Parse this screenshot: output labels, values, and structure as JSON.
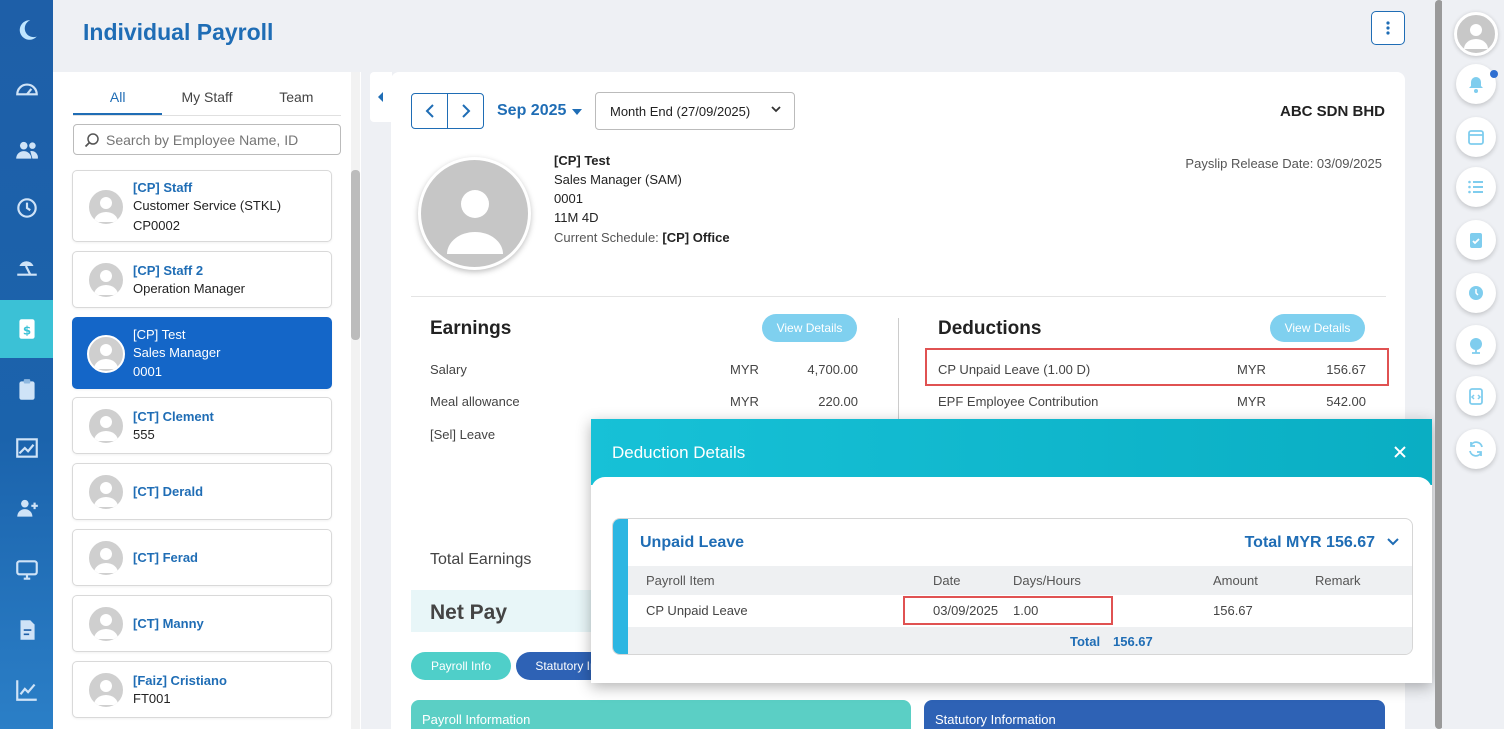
{
  "header": {
    "title": "Individual Payroll"
  },
  "left_nav": [
    "logo-icon",
    "dashboard-icon",
    "people-icon",
    "history-icon",
    "leave-icon",
    "payroll-icon",
    "clipboard-icon",
    "chart-icon",
    "add-user-icon",
    "monitor-icon",
    "document-icon",
    "report-icon"
  ],
  "employees_panel": {
    "tabs": [
      "All",
      "My Staff",
      "Team"
    ],
    "active_tab": "All",
    "search_placeholder": "Search by Employee Name, ID",
    "list": [
      {
        "name": "[CP] Staff",
        "line2": "Customer Service (STKL)",
        "line3": "CP0002"
      },
      {
        "name": "[CP] Staff 2",
        "line2": "Operation Manager",
        "line3": ""
      },
      {
        "name": "[CP] Test",
        "line2": "Sales Manager",
        "line3": "0001",
        "selected": true
      },
      {
        "name": "[CT] Clement",
        "line2": "555",
        "line3": ""
      },
      {
        "name": "[CT] Derald",
        "line2": "",
        "line3": ""
      },
      {
        "name": "[CT] Ferad",
        "line2": "",
        "line3": ""
      },
      {
        "name": "[CT] Manny",
        "line2": "",
        "line3": ""
      },
      {
        "name": "[Faiz] Cristiano",
        "line2": "FT001",
        "line3": ""
      }
    ]
  },
  "payslip": {
    "period": "Sep 2025",
    "run": "Month End (27/09/2025)",
    "company": "ABC SDN BHD",
    "employee": {
      "name": "[CP] Test",
      "position": "Sales Manager (SAM)",
      "id": "0001",
      "tenure": "11M 4D",
      "schedule_label": "Current Schedule:",
      "schedule_value": "[CP] Office"
    },
    "release_date": "Payslip Release Date: 03/09/2025",
    "earnings": {
      "title": "Earnings",
      "view_label": "View Details",
      "rows": [
        {
          "label": "Salary",
          "currency": "MYR",
          "amount": "4,700.00"
        },
        {
          "label": "Meal allowance",
          "currency": "MYR",
          "amount": "220.00"
        },
        {
          "label": "[Sel] Leave",
          "currency": "",
          "amount": ""
        }
      ],
      "total_label": "Total Earnings"
    },
    "deductions": {
      "title": "Deductions",
      "view_label": "View Details",
      "rows": [
        {
          "label": "CP Unpaid Leave (1.00 D)",
          "currency": "MYR",
          "amount": "156.67"
        },
        {
          "label": "EPF Employee Contribution",
          "currency": "MYR",
          "amount": "542.00"
        }
      ]
    },
    "net_pay_label": "Net Pay",
    "tabs": [
      "Payroll Info",
      "Statutory Info"
    ],
    "sections": [
      "Payroll Information",
      "Statutory Information"
    ]
  },
  "modal": {
    "title": "Deduction Details",
    "group_title": "Unpaid Leave",
    "group_total": "Total MYR 156.67",
    "columns": [
      "Payroll Item",
      "Date",
      "Days/Hours",
      "Amount",
      "Remark"
    ],
    "rows": [
      {
        "item": "CP Unpaid Leave",
        "date": "03/09/2025",
        "days": "1.00",
        "amount": "156.67",
        "remark": ""
      }
    ],
    "total_label": "Total",
    "total_value": "156.67"
  },
  "colors": {
    "primary": "#1f6db5",
    "teal": "#17c1d7",
    "highlight": "#e05252",
    "nav_bg": "#1e5fa8"
  },
  "right_rail": [
    "profile-icon",
    "bell-icon",
    "calendar-icon",
    "list-icon",
    "checklist-icon",
    "clock-icon",
    "globe-icon",
    "code-icon",
    "refresh-icon"
  ]
}
